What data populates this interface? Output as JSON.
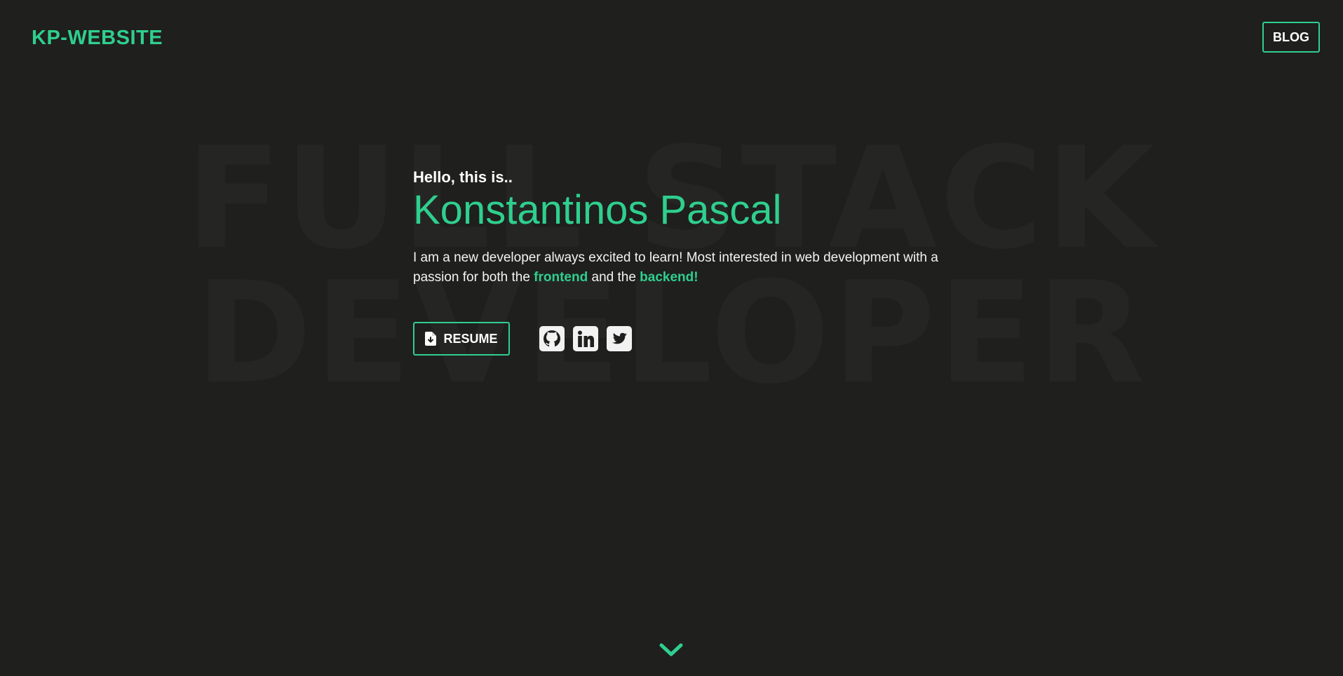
{
  "header": {
    "logo": "KP-WEBSITE",
    "blog_label": "BLOG"
  },
  "background": {
    "line1": "FULL STACK",
    "line2": "DEVELOPER"
  },
  "hero": {
    "greeting": "Hello, this is..",
    "name": "Konstantinos Pascal",
    "intro_part1": "I am a new developer always excited to learn! Most interested in web development with a passion for both the ",
    "highlight1": "frontend",
    "intro_part2": " and the ",
    "highlight2": "backend!"
  },
  "actions": {
    "resume_label": "RESUME",
    "resume_icon": "file-download-icon",
    "socials": [
      "github-icon",
      "linkedin-icon",
      "twitter-icon"
    ]
  },
  "scroll": {
    "icon": "chevron-down-icon"
  },
  "colors": {
    "background": "#1f1f1e",
    "accent": "#2fcf8e",
    "text": "#ffffff",
    "watermark": "#252624"
  }
}
